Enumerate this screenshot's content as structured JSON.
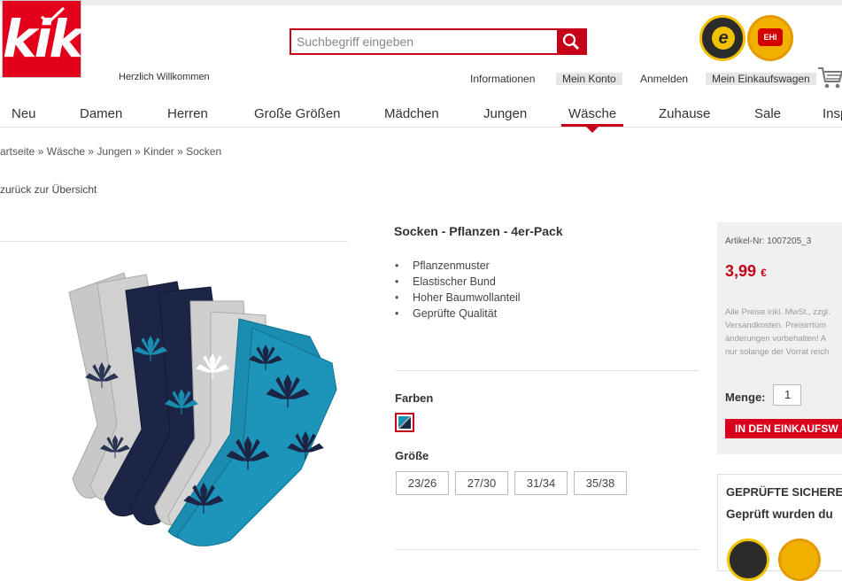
{
  "brand": {
    "logo_text": "kik",
    "brand_color": "#c7001a"
  },
  "header": {
    "welcome": "Herzlich Willkommen",
    "search_placeholder": "Suchbegriff eingeben",
    "links": [
      "Informationen",
      "Mein Konto",
      "Anmelden",
      "Mein Einkaufswagen"
    ],
    "badges": {
      "trusted_shops_letter": "e",
      "ehi_text": "EHI"
    }
  },
  "nav": {
    "items": [
      "Neu",
      "Damen",
      "Herren",
      "Große Größen",
      "Mädchen",
      "Jungen",
      "Wäsche",
      "Zuhause",
      "Sale",
      "Insp"
    ],
    "active": "Wäsche"
  },
  "breadcrumb": "artseite » Wäsche » Jungen » Kinder » Socken",
  "back_link": "zurück zur Übersicht",
  "product": {
    "title": "Socken - Pflanzen - 4er-Pack",
    "features": [
      "Pflanzenmuster",
      "Elastischer Bund",
      "Hoher Baumwollanteil",
      "Geprüfte Qualität"
    ],
    "colors_label": "Farben",
    "sizes_label": "Größe",
    "sizes": [
      "23/26",
      "27/30",
      "31/34",
      "35/38"
    ]
  },
  "buybox": {
    "article_nr": "Artikel-Nr: 1007205_3",
    "price": "3,99",
    "currency": "€",
    "legal_lines": [
      "Alle Preise inkl. MwSt., zzgl.",
      "Versandkosten. Preisirrtüm",
      "änderungen vorbehalten! A",
      "nur solange der Vorrat reich"
    ],
    "quantity_label": "Menge:",
    "quantity": "1",
    "cart_button": "IN DEN EINKAUFSW"
  },
  "trust": {
    "heading": "GEPRÜFTE SICHERE",
    "subheading": "Geprüft wurden du"
  }
}
